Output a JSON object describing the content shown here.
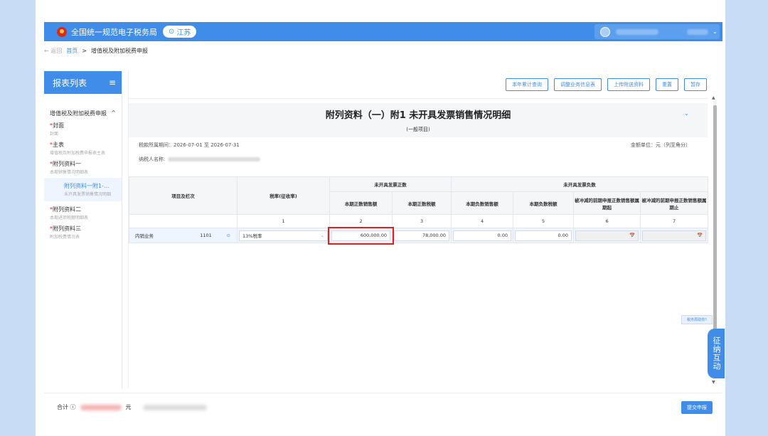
{
  "header": {
    "site_title": "全国统一规范电子税务局",
    "province": "江苏"
  },
  "breadcrumb": {
    "back": "← 返回",
    "home": "首页",
    "separator": ">",
    "current": "增值税及附加税费申报"
  },
  "sidebar": {
    "title": "报表列表",
    "menu_icon": "≡",
    "group": "增值税及附加税费申报",
    "group_caret": "^",
    "items": [
      {
        "title": "封面",
        "sub": "封面",
        "required": "*"
      },
      {
        "title": "主表",
        "sub": "增值税及附加税费申报表主表",
        "required": "*"
      },
      {
        "title": "附列资料一",
        "sub": "本期销售情况明细表",
        "required": "*"
      },
      {
        "title": "附列资料一附1-...",
        "sub": "未开具发票销售情况明细"
      },
      {
        "title": "附列资料二",
        "sub": "本期进项税额明细表",
        "required": "*"
      },
      {
        "title": "附列资料三",
        "sub": "附加税费情况表",
        "required": "*"
      }
    ]
  },
  "toolbar": {
    "buttons": [
      "本年累计查询",
      "调整业务信息表",
      "上传附送资料",
      "重置",
      "暂存"
    ]
  },
  "form": {
    "title": "附列资料（一）附1 未开具发票销售情况明细",
    "subtitle": "(一般项目)",
    "period_label": "税款所属期间：",
    "period_value": "2026-07-01 至 2026-07-31",
    "unit": "金额单位：元（列至角分）",
    "taxpayer_label": "纳税人名称:",
    "collapse_icon": "⌄"
  },
  "table": {
    "col_item": "项目及栏次",
    "col_rate": "税率(征收率)",
    "group_positive": "未开具发票正数",
    "group_negative": "未开具发票负数",
    "sub_headers": [
      "本期正数销售额",
      "本期正数税额",
      "本期负数销售额",
      "本期负数税额",
      "被冲减的前期申报正数销售额属期起",
      "被冲减的前期申报正数销售额属期止"
    ],
    "col_numbers": [
      "1",
      "2",
      "3",
      "4",
      "5",
      "6",
      "7"
    ],
    "row": {
      "item": "内销业务",
      "code": "1101",
      "info_icon": "⊙",
      "rate": "13%税率",
      "rate_caret": "⌄",
      "pos_sales": "600,000.00",
      "pos_tax": "78,000.00",
      "neg_sales": "0.00",
      "neg_tax": "0.00",
      "calendar_icon": "📅"
    }
  },
  "footer": {
    "total_label": "合计 ⓘ",
    "currency": "元",
    "submit": "提交申报"
  },
  "help_tip": "税务局助你?",
  "float_button": "征纳互动",
  "scroll_up": "▲",
  "scroll_down": "▼"
}
